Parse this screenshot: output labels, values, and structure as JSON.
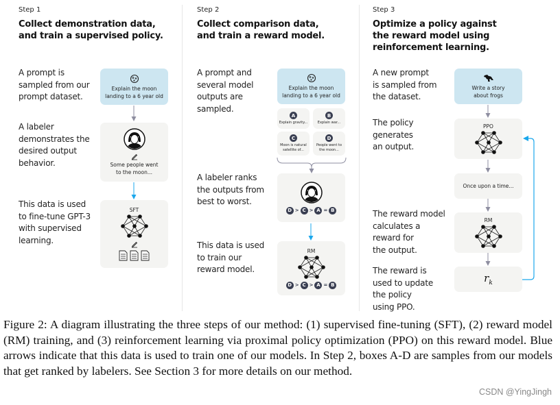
{
  "steps": [
    {
      "label": "Step 1",
      "title": [
        "Collect demonstration data,",
        "and train a supervised policy."
      ],
      "descriptions": [
        [
          "A prompt is",
          "sampled from our",
          "prompt dataset."
        ],
        [
          "A labeler",
          "demonstrates the",
          "desired output",
          "behavior."
        ],
        [
          "This data is used",
          "to fine-tune GPT-3",
          "with supervised",
          "learning."
        ]
      ],
      "prompt_box": [
        "Explain the moon",
        "landing to a 6 year old"
      ],
      "labeler_output": [
        "Some people went",
        "to the moon..."
      ],
      "model_label": "SFT"
    },
    {
      "label": "Step 2",
      "title": [
        "Collect comparison data,",
        "and train a reward model."
      ],
      "descriptions": [
        [
          "A prompt and",
          "several model",
          "outputs are",
          "sampled."
        ],
        [
          "A labeler ranks",
          "the outputs from",
          "best to worst."
        ],
        [
          "This data is used",
          "to train our",
          "reward model."
        ]
      ],
      "prompt_box": [
        "Explain the moon",
        "landing to a 6 year old"
      ],
      "samples": [
        {
          "letter": "A",
          "text": [
            "Explain gravity..."
          ]
        },
        {
          "letter": "B",
          "text": [
            "Explain war..."
          ]
        },
        {
          "letter": "C",
          "text": [
            "Moon is natural",
            "satellite of..."
          ]
        },
        {
          "letter": "D",
          "text": [
            "People went to",
            "the moon..."
          ]
        }
      ],
      "ranking": [
        "D",
        ">",
        "C",
        ">",
        "A",
        "=",
        "B"
      ],
      "model_label": "RM"
    },
    {
      "label": "Step 3",
      "title": [
        "Optimize a policy against",
        "the reward model using",
        "reinforcement learning."
      ],
      "descriptions": [
        [
          "A new prompt",
          "is sampled from",
          "the dataset."
        ],
        [
          "The policy",
          "generates",
          "an output."
        ],
        [
          "The reward model",
          "calculates a",
          "reward for",
          "the output."
        ],
        [
          "The reward is",
          "used to update",
          "the policy",
          "using PPO."
        ]
      ],
      "prompt_box": [
        "Write a story",
        "about frogs"
      ],
      "policy_label": "PPO",
      "output_text": "Once upon a time...",
      "model_label": "RM",
      "reward_symbol": "r",
      "reward_subscript": "k"
    }
  ],
  "colors": {
    "prompt_box": "#cde6f1",
    "neutral_box": "#f4f4f2",
    "blue_arrow": "#1aa7ec",
    "gray_arrow": "#8e8ea0",
    "rank_circle": "#3a3f52"
  },
  "caption": "Figure 2: A diagram illustrating the three steps of our method: (1) supervised fine-tuning (SFT), (2) reward model (RM) training, and (3) reinforcement learning via proximal policy optimization (PPO) on this reward model. Blue arrows indicate that this data is used to train one of our models. In Step 2, boxes A-D are samples from our models that get ranked by labelers. See Section 3 for more details on our method.",
  "watermark": "CSDN @YingJingh"
}
